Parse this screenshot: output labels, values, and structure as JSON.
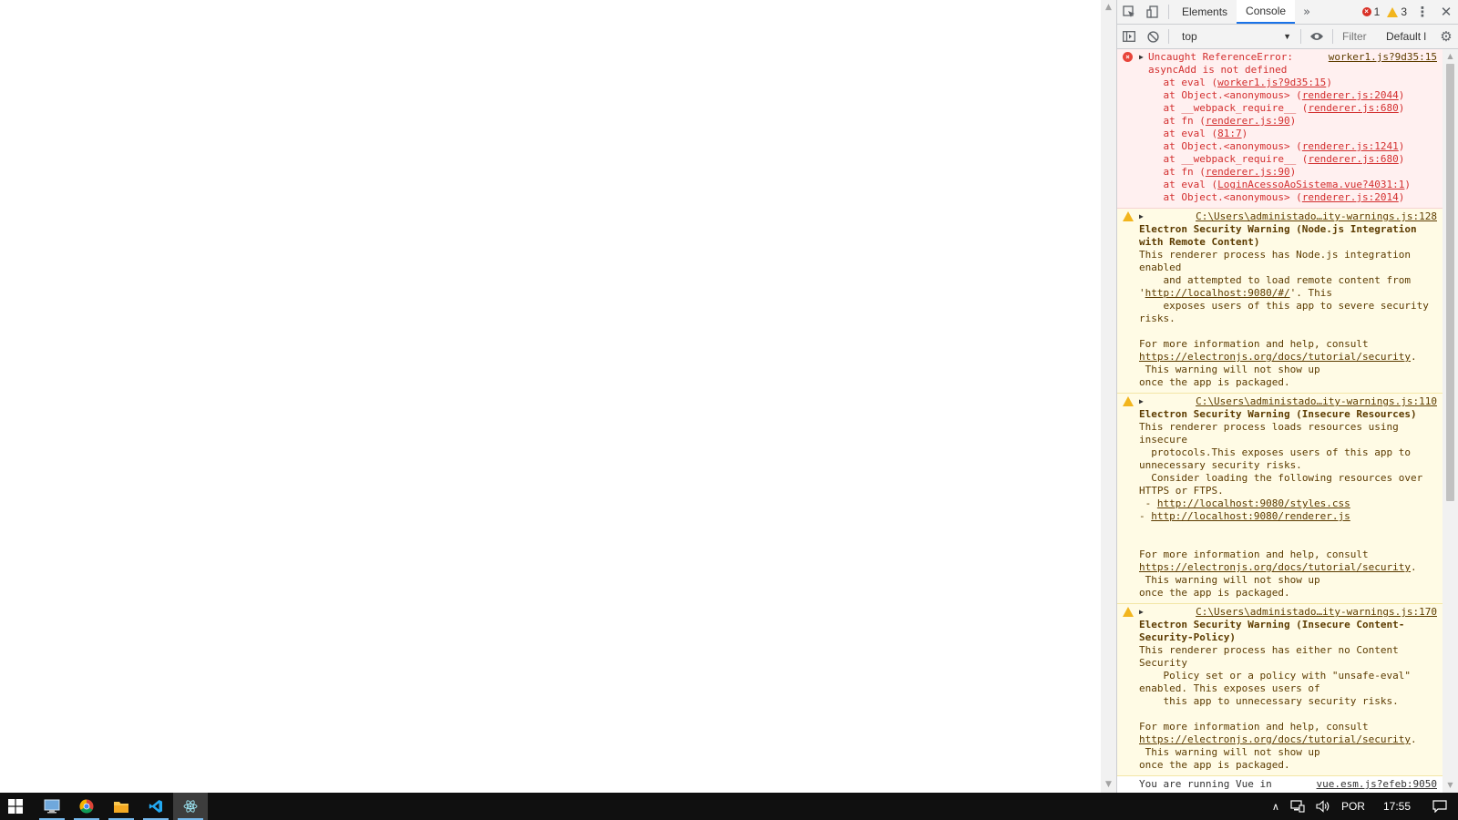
{
  "devtools": {
    "tabs": [
      "Elements",
      "Console"
    ],
    "active_tab": "Console",
    "error_count": "1",
    "warning_count": "3",
    "context": "top",
    "filter_placeholder": "Filter",
    "levels_label": "Default levels"
  },
  "console": {
    "error": {
      "title": "Uncaught ReferenceError: asyncAdd is not defined",
      "source": "worker1.js?9d35:15",
      "stack": [
        {
          "pre": "    at eval (",
          "link": "worker1.js?9d35:15",
          "post": ")"
        },
        {
          "pre": "    at Object.<anonymous> (",
          "link": "renderer.js:2044",
          "post": ")"
        },
        {
          "pre": "    at __webpack_require__ (",
          "link": "renderer.js:680",
          "post": ")"
        },
        {
          "pre": "    at fn (",
          "link": "renderer.js:90",
          "post": ")"
        },
        {
          "pre": "    at eval (",
          "link": "81:7",
          "post": ")"
        },
        {
          "pre": "    at Object.<anonymous> (",
          "link": "renderer.js:1241",
          "post": ")"
        },
        {
          "pre": "    at __webpack_require__ (",
          "link": "renderer.js:680",
          "post": ")"
        },
        {
          "pre": "    at fn (",
          "link": "renderer.js:90",
          "post": ")"
        },
        {
          "pre": "    at eval (",
          "link": "LoginAcessoAoSistema.vue?4031:1",
          "post": ")"
        },
        {
          "pre": "    at Object.<anonymous> (",
          "link": "renderer.js:2014",
          "post": ")"
        }
      ]
    },
    "warnings": [
      {
        "source": "C:\\Users\\administado…ity-warnings.js:128",
        "title": "Electron Security Warning (Node.js Integration with Remote Content)",
        "lines": [
          {
            "text": "This renderer process has Node.js integration enabled"
          },
          {
            "text": "    and attempted to load remote content from"
          },
          {
            "pre": "'",
            "link": "http://localhost:9080/#/",
            "post": "'. This"
          },
          {
            "text": "    exposes users of this app to severe security risks."
          },
          {
            "text": " "
          },
          {
            "text": "For more information and help, consult"
          },
          {
            "link": "https://electronjs.org/docs/tutorial/security",
            "post": "."
          },
          {
            "text": " This warning will not show up"
          },
          {
            "text": "once the app is packaged."
          }
        ]
      },
      {
        "source": "C:\\Users\\administado…ity-warnings.js:110",
        "title": "Electron Security Warning (Insecure Resources)",
        "lines": [
          {
            "text": "This renderer process loads resources using insecure"
          },
          {
            "text": "  protocols.This exposes users of this app to unnecessary security risks."
          },
          {
            "text": "  Consider loading the following resources over HTTPS or FTPS."
          },
          {
            "pre": " - ",
            "link": "http://localhost:9080/styles.css"
          },
          {
            "pre": "- ",
            "link": "http://localhost:9080/renderer.js"
          },
          {
            "text": " "
          },
          {
            "text": " "
          },
          {
            "text": "For more information and help, consult"
          },
          {
            "link": "https://electronjs.org/docs/tutorial/security",
            "post": "."
          },
          {
            "text": " This warning will not show up"
          },
          {
            "text": "once the app is packaged."
          }
        ]
      },
      {
        "source": "C:\\Users\\administado…ity-warnings.js:170",
        "title": "Electron Security Warning (Insecure Content-Security-Policy)",
        "lines": [
          {
            "text": "This renderer process has either no Content Security"
          },
          {
            "text": "    Policy set or a policy with \"unsafe-eval\""
          },
          {
            "text": "enabled. This exposes users of"
          },
          {
            "text": "    this app to unnecessary security risks."
          },
          {
            "text": " "
          },
          {
            "text": "For more information and help, consult"
          },
          {
            "link": "https://electronjs.org/docs/tutorial/security",
            "post": "."
          },
          {
            "text": " This warning will not show up"
          },
          {
            "text": "once the app is packaged."
          }
        ]
      }
    ],
    "info": {
      "text": "You are running Vue in",
      "source": "vue.esm.js?efeb:9050"
    }
  },
  "taskbar": {
    "language": "POR",
    "time": "17:55"
  },
  "colors": {
    "error_text": "#d32f2f",
    "warning_text": "#5c3b00",
    "accent": "#1a73e8",
    "taskbar": "#101010"
  }
}
